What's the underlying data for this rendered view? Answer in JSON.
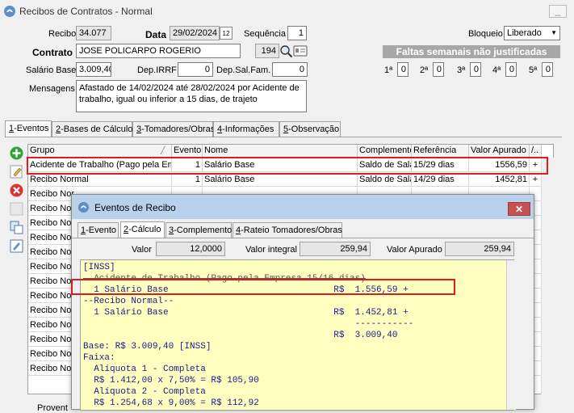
{
  "window": {
    "title": "Recibos de Contratos - Normal",
    "minimize": "_"
  },
  "header": {
    "recibo_label": "Recibo",
    "recibo": "34.077",
    "data_label": "Data",
    "data": "29/02/2024",
    "calendar_day": "12",
    "sequencia_label": "Sequência",
    "sequencia": "1",
    "bloqueio_label": "Bloqueio",
    "bloqueio": "Liberado",
    "contrato_label": "Contrato",
    "contrato_nome": "JOSE POLICARPO ROGERIO",
    "contrato_codigo": "194",
    "salario_label": "Salário Base",
    "salario": "3.009,40",
    "depirrf_label": "Dep.IRRF",
    "depirrf": "0",
    "depsalfam_label": "Dep.Sal.Fam.",
    "depsalfam": "0",
    "mensagens_label": "Mensagens",
    "mensagens_l1": "Afastado de 14/02/2024 até 28/02/2024 por Acidente de",
    "mensagens_l2": "trabalho, igual ou inferior a 15 dias, de trajeto",
    "faltas_title": "Faltas semanais não justificadas",
    "faltas": [
      {
        "label": "1ª",
        "value": "0"
      },
      {
        "label": "2ª",
        "value": "0"
      },
      {
        "label": "3ª",
        "value": "0"
      },
      {
        "label": "4ª",
        "value": "0"
      },
      {
        "label": "5ª",
        "value": "0"
      }
    ]
  },
  "tabs": [
    {
      "key": "1",
      "rest": "-Eventos"
    },
    {
      "key": "2",
      "rest": "-Bases de Cálculo"
    },
    {
      "key": "3",
      "rest": "-Tomadores/Obras"
    },
    {
      "key": "4",
      "rest": "-Informações"
    },
    {
      "key": "5",
      "rest": "-Observação"
    }
  ],
  "grid": {
    "columns": {
      "grupo": "Grupo",
      "evento": "Evento",
      "nome": "Nome",
      "complemento": "Complemento",
      "referencia": "Referência",
      "valor": "Valor Apurado",
      "extra": "/.."
    },
    "rows": [
      {
        "grupo": "Acidente de Trabalho (Pago pela Em",
        "evento": "1",
        "nome": "Salário Base",
        "complemento": "Saldo de Salá",
        "referencia": "15/29 dias",
        "valor": "1556,59",
        "sinal": "+"
      },
      {
        "grupo": "Recibo Normal",
        "evento": "1",
        "nome": "Salário Base",
        "complemento": "Saldo de Salá",
        "referencia": "14/29 dias",
        "valor": "1452,81",
        "sinal": "+"
      },
      {
        "grupo": "Recibo Nor",
        "evento": "",
        "nome": "",
        "complemento": "",
        "referencia": "",
        "valor": "",
        "sinal": ""
      },
      {
        "grupo": "Recibo Nor",
        "evento": "",
        "nome": "",
        "complemento": "",
        "referencia": "",
        "valor": "",
        "sinal": ""
      },
      {
        "grupo": "Recibo Nor",
        "evento": "",
        "nome": "",
        "complemento": "",
        "referencia": "",
        "valor": "",
        "sinal": ""
      },
      {
        "grupo": "Recibo Nor",
        "evento": "",
        "nome": "",
        "complemento": "",
        "referencia": "",
        "valor": "",
        "sinal": ""
      },
      {
        "grupo": "Recibo Nor",
        "evento": "",
        "nome": "",
        "complemento": "",
        "referencia": "",
        "valor": "",
        "sinal": ""
      },
      {
        "grupo": "Recibo Nor",
        "evento": "",
        "nome": "",
        "complemento": "",
        "referencia": "",
        "valor": "",
        "sinal": ""
      },
      {
        "grupo": "Recibo Nor",
        "evento": "",
        "nome": "",
        "complemento": "",
        "referencia": "",
        "valor": "",
        "sinal": ""
      },
      {
        "grupo": "Recibo Nor",
        "evento": "",
        "nome": "",
        "complemento": "",
        "referencia": "",
        "valor": "",
        "sinal": ""
      },
      {
        "grupo": "Recibo Nor",
        "evento": "",
        "nome": "",
        "complemento": "",
        "referencia": "",
        "valor": "",
        "sinal": ""
      },
      {
        "grupo": "Recibo Nor",
        "evento": "",
        "nome": "",
        "complemento": "",
        "referencia": "",
        "valor": "",
        "sinal": ""
      },
      {
        "grupo": "Recibo Nor",
        "evento": "",
        "nome": "",
        "complemento": "",
        "referencia": "",
        "valor": "",
        "sinal": ""
      },
      {
        "grupo": "Recibo Nor",
        "evento": "",
        "nome": "",
        "complemento": "",
        "referencia": "",
        "valor": "",
        "sinal": ""
      },
      {
        "grupo": "Recibo Nor",
        "evento": "",
        "nome": "",
        "complemento": "",
        "referencia": "",
        "valor": "",
        "sinal": ""
      }
    ]
  },
  "footer": {
    "proventos_label": "Provent"
  },
  "dialog": {
    "title": "Eventos de Recibo",
    "close": "✕",
    "tabs": [
      {
        "key": "1",
        "rest": "-Evento"
      },
      {
        "key": "2",
        "rest": "-Cálculo"
      },
      {
        "key": "3",
        "rest": "-Complemento"
      },
      {
        "key": "4",
        "rest": "-Rateio Tomadores/Obras"
      }
    ],
    "valor_label": "Valor",
    "valor": "12,0000",
    "valor_integral_label": "Valor integral",
    "valor_integral": "259,94",
    "valor_apurado_label": "Valor Apurado",
    "valor_apurado": "259,94",
    "memo_lines": [
      "[INSS]",
      "  Acidente de Trabalho (Pago pela Empresa 15/16 dias)",
      "  1 Salário Base                               R$  1.556,59 +",
      "--Recibo Normal--",
      "  1 Salário Base                               R$  1.452,81 +",
      "                                                   -----------",
      "                                               R$  3.009,40",
      "Base: R$ 3.009,40 [INSS]",
      "Faixa:",
      "  Alíquota 1 - Completa",
      "  R$ 1.412,00 x 7,50% = R$ 105,90",
      "  Alíquota 2 - Completa",
      "  R$ 1.254,68 x 9,00% = R$ 112,92"
    ]
  },
  "colors": {
    "highlight": "#e01a22",
    "memo_bg": "#ffffc0",
    "memo_text": "#1a1a8c",
    "dialog_title": "#b9d1ea",
    "faltas_bar": "#a7a7a7"
  }
}
